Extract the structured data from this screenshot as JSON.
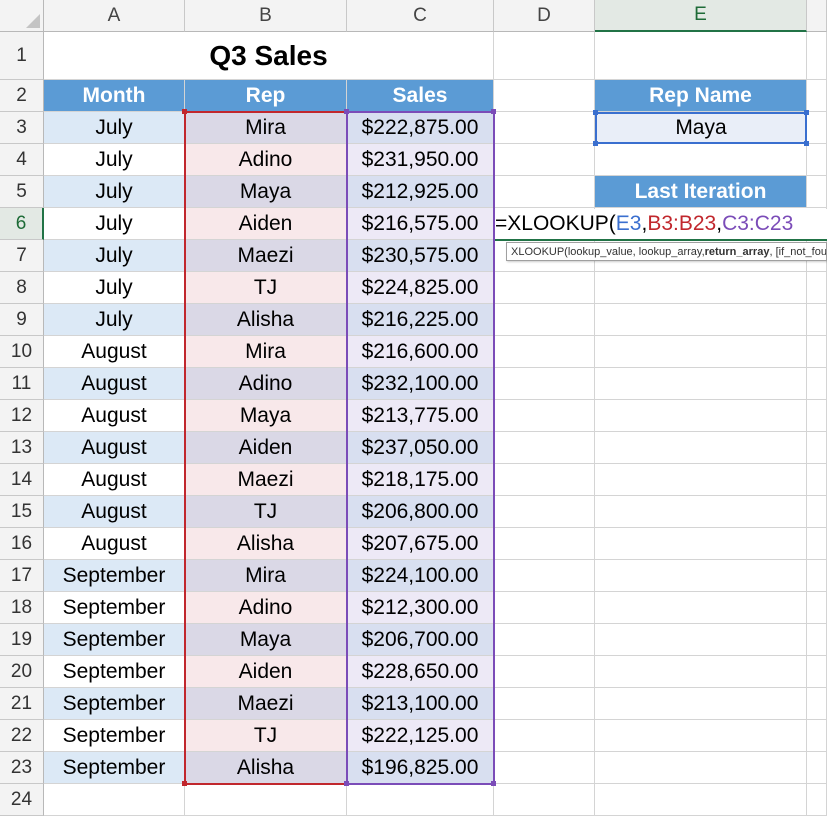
{
  "columns": [
    "A",
    "B",
    "C",
    "D",
    "E"
  ],
  "active_column": "E",
  "active_row": 6,
  "title": "Q3 Sales",
  "headers": {
    "month": "Month",
    "rep": "Rep",
    "sales": "Sales"
  },
  "rows": [
    {
      "row": 3,
      "month": "July",
      "rep": "Mira",
      "sales": "$222,875.00"
    },
    {
      "row": 4,
      "month": "July",
      "rep": "Adino",
      "sales": "$231,950.00"
    },
    {
      "row": 5,
      "month": "July",
      "rep": "Maya",
      "sales": "$212,925.00"
    },
    {
      "row": 6,
      "month": "July",
      "rep": "Aiden",
      "sales": "$216,575.00"
    },
    {
      "row": 7,
      "month": "July",
      "rep": "Maezi",
      "sales": "$230,575.00"
    },
    {
      "row": 8,
      "month": "July",
      "rep": "TJ",
      "sales": "$224,825.00"
    },
    {
      "row": 9,
      "month": "July",
      "rep": "Alisha",
      "sales": "$216,225.00"
    },
    {
      "row": 10,
      "month": "August",
      "rep": "Mira",
      "sales": "$216,600.00"
    },
    {
      "row": 11,
      "month": "August",
      "rep": "Adino",
      "sales": "$232,100.00"
    },
    {
      "row": 12,
      "month": "August",
      "rep": "Maya",
      "sales": "$213,775.00"
    },
    {
      "row": 13,
      "month": "August",
      "rep": "Aiden",
      "sales": "$237,050.00"
    },
    {
      "row": 14,
      "month": "August",
      "rep": "Maezi",
      "sales": "$218,175.00"
    },
    {
      "row": 15,
      "month": "August",
      "rep": "TJ",
      "sales": "$206,800.00"
    },
    {
      "row": 16,
      "month": "August",
      "rep": "Alisha",
      "sales": "$207,675.00"
    },
    {
      "row": 17,
      "month": "September",
      "rep": "Mira",
      "sales": "$224,100.00"
    },
    {
      "row": 18,
      "month": "September",
      "rep": "Adino",
      "sales": "$212,300.00"
    },
    {
      "row": 19,
      "month": "September",
      "rep": "Maya",
      "sales": "$206,700.00"
    },
    {
      "row": 20,
      "month": "September",
      "rep": "Aiden",
      "sales": "$228,650.00"
    },
    {
      "row": 21,
      "month": "September",
      "rep": "Maezi",
      "sales": "$213,100.00"
    },
    {
      "row": 22,
      "month": "September",
      "rep": "TJ",
      "sales": "$222,125.00"
    },
    {
      "row": 23,
      "month": "September",
      "rep": "Alisha",
      "sales": "$196,825.00"
    }
  ],
  "rep_name_label": "Rep Name",
  "rep_name_value": "Maya",
  "last_iteration_label": "Last Iteration",
  "formula": {
    "prefix": "=XLOOKUP(",
    "arg1": "E3",
    "sep1": ", ",
    "arg2": "B3:B23",
    "sep2": ", ",
    "arg3": "C3:C23"
  },
  "tooltip": {
    "pre": "XLOOKUP(lookup_value, lookup_array, ",
    "bold": "return_array",
    "post": ", [if_not_found], [match_mode], [search_mode])"
  },
  "colors": {
    "header_blue": "#5b9bd5",
    "month_band": "#dce9f6",
    "rep_a": "#dad8e6",
    "rep_b": "#f8e8ea",
    "sales_a": "#d8dff0",
    "sales_b": "#ede9f6",
    "ref_e3": "#3a6fcf",
    "ref_b": "#c1272d",
    "ref_c": "#7b4cb8",
    "active_green": "#217346"
  }
}
